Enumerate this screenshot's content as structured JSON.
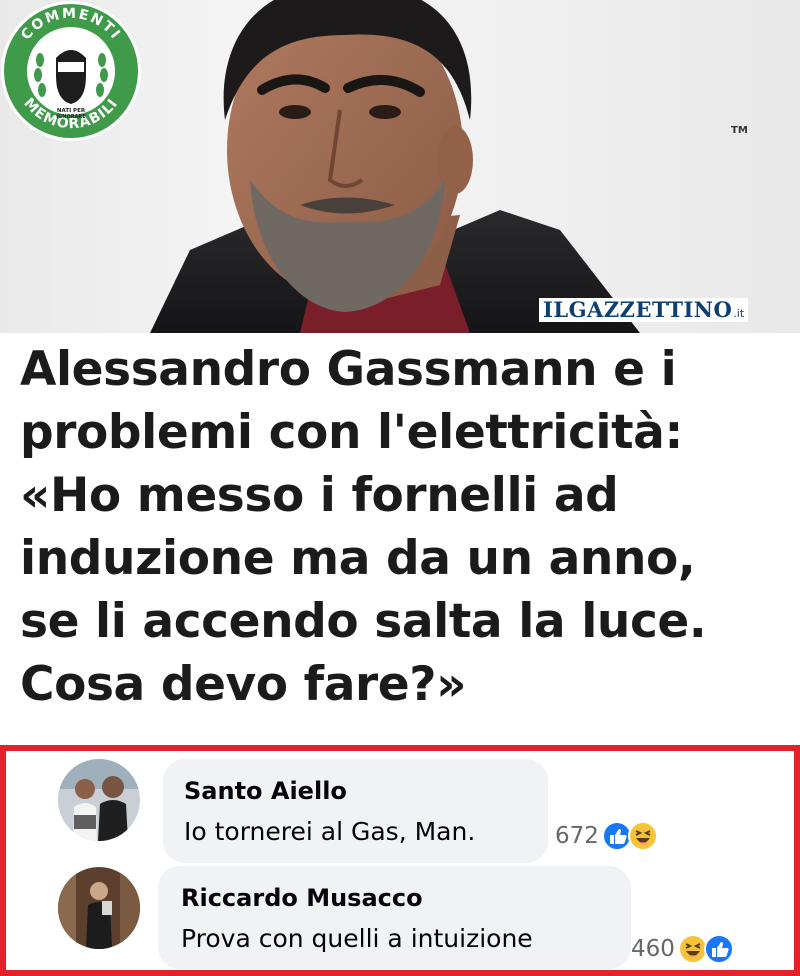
{
  "photo": {
    "subject": "portrait-photo",
    "badge": {
      "top_text": "COMMENTI",
      "bottom_text": "MEMORABILI",
      "tagline_1": "NATI PER",
      "tagline_2": "IGNORARE",
      "tm": "TM",
      "color": "#3f9a4a"
    },
    "source_logo": {
      "name": "ILGAZZETTINO",
      "tld": ".it",
      "color": "#0e3f73"
    }
  },
  "headline": {
    "lines": [
      "Alessandro Gassmann e i",
      "problemi con l'elettricità:",
      "«Ho messo i fornelli ad",
      "induzione ma da un anno,",
      "se li accendo salta la luce.",
      "Cosa devo fare?»"
    ]
  },
  "comments": {
    "border_color": "#e5222b",
    "items": [
      {
        "author": "Santo Aiello",
        "text": "Io tornerei al Gas, Man.",
        "reaction_count": "672",
        "reactions": [
          "like-icon",
          "haha-icon"
        ]
      },
      {
        "author": "Riccardo Musacco",
        "text": "Prova con quelli a intuizione",
        "reaction_count": "460",
        "reactions": [
          "haha-icon",
          "like-icon"
        ]
      }
    ]
  }
}
